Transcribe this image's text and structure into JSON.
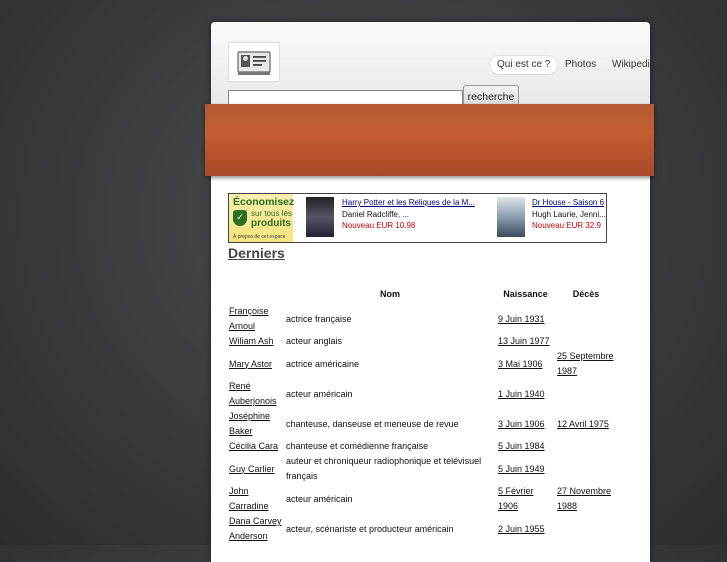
{
  "nav": {
    "items": [
      {
        "label": "Qui est ce ?",
        "active": true
      },
      {
        "label": "Photos",
        "active": false
      },
      {
        "label": "Wikipedia",
        "active": false
      }
    ]
  },
  "search": {
    "value": "",
    "button_label": "recherche"
  },
  "colors": {
    "banner": "#b35a33",
    "ad_green": "#2a6e1f",
    "price_red": "#cc0000"
  },
  "ad": {
    "title": "Économisez",
    "line1": "sur tous les",
    "line2": "produits",
    "small": "À propos de cet espace",
    "products": [
      {
        "title": "Harry Potter et les Reliques de la M...",
        "actors": "Daniel Radcliffe, ...",
        "price": "Nouveau EUR 10.98"
      },
      {
        "title": "Dr House - Saison 6",
        "actors": "Hugh Laurie, Jenni...",
        "price": "Nouveau EUR 32.9"
      }
    ]
  },
  "section": {
    "title": "Derniers"
  },
  "table": {
    "headers": {
      "name": "Nom",
      "birth": "Naissance",
      "death": "Décès"
    },
    "rows": [
      {
        "name": "Françoise Arnoul",
        "desc": "actrice française",
        "birth": "9 Juin 1931",
        "death": ""
      },
      {
        "name": "Wiliam Ash",
        "desc": "acteur anglais",
        "birth": "13 Juin 1977",
        "death": ""
      },
      {
        "name": "Mary Astor",
        "desc": "actrice américaine",
        "birth": "3 Mai 1906",
        "death": "25 Septembre 1987"
      },
      {
        "name": "René Auberjonois",
        "desc": "acteur américain",
        "birth": "1 Juin 1940",
        "death": ""
      },
      {
        "name": "Joséphine Baker",
        "desc": "chanteuse, danseuse et meneuse de revue",
        "birth": "3 Juin 1906",
        "death": "12 Avril 1975"
      },
      {
        "name": "Cécilia Cara",
        "desc": "chanteuse et comédienne française",
        "birth": "5 Juin 1984",
        "death": ""
      },
      {
        "name": "Guy Carlier",
        "desc": "auteur et chroniqueur radiophonique et télévisuel français",
        "birth": "5 Juin 1949",
        "death": ""
      },
      {
        "name": "John Carradine",
        "desc": "acteur américain",
        "birth": "5 Février 1906",
        "death": "27 Novembre 1988"
      },
      {
        "name": "Dana Carvey Anderson",
        "desc": "acteur, scénariste et producteur américain",
        "birth": "2 Juin 1955",
        "death": ""
      }
    ]
  }
}
